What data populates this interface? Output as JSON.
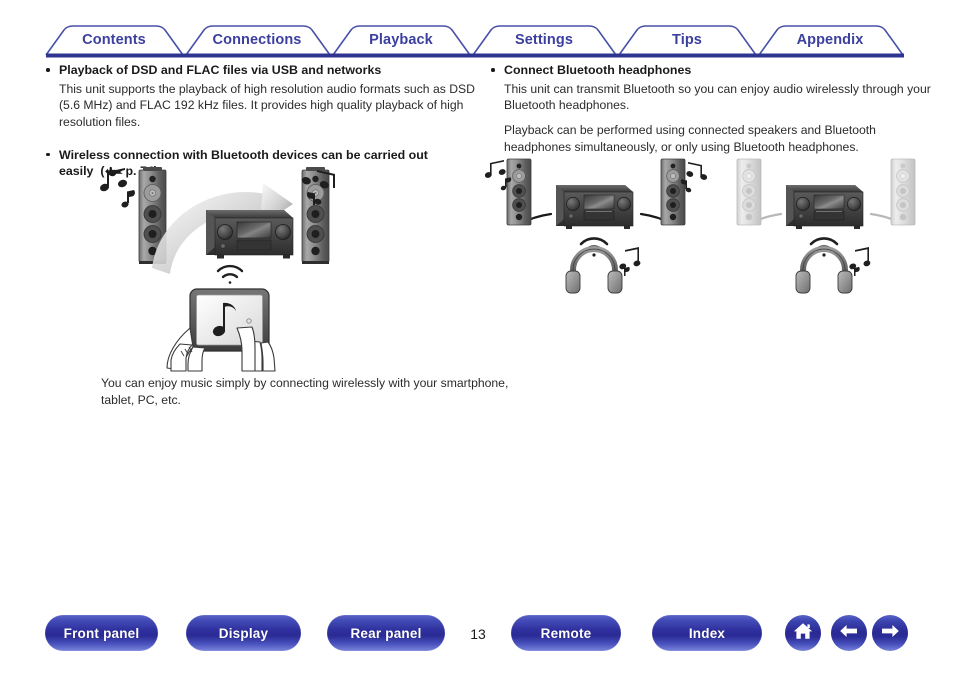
{
  "tabs": [
    {
      "label": "Contents"
    },
    {
      "label": "Connections"
    },
    {
      "label": "Playback"
    },
    {
      "label": "Settings"
    },
    {
      "label": "Tips"
    },
    {
      "label": "Appendix"
    }
  ],
  "theme": {
    "tab_text_color": "#3b3f9e",
    "tab_border_color": "#4950a8",
    "tab_rule_color": "#2f3490",
    "pill_color": "#2b2b96",
    "pill_text_color": "#ffffff",
    "body_text_color": "#2b2b2b"
  },
  "left_column": {
    "items": [
      {
        "heading": "Playback of DSD and FLAC files via USB and networks",
        "paragraphs": [
          "This unit supports the playback of high resolution audio formats such as DSD (5.6 MHz) and FLAC 192 kHz files. It provides high quality playback of high resolution files."
        ]
      },
      {
        "heading_part1": "Wireless connection with Bluetooth devices can be carried out",
        "heading_part2": "easily",
        "link_open": "(",
        "link_icon": "pointing-hand-icon",
        "link_text": "p. 74",
        "link_close": ")"
      }
    ],
    "caption": "You can enjoy music simply by connecting wirelessly with your smartphone, tablet, PC, etc.",
    "illustration": {
      "name": "wireless-streaming-diagram",
      "elements": [
        "left-speaker",
        "music-notes",
        "curved-arrow",
        "av-receiver",
        "right-speaker",
        "wifi-signal",
        "tablet-with-music-note",
        "hands"
      ]
    }
  },
  "right_column": {
    "items": [
      {
        "heading": "Connect Bluetooth headphones",
        "paragraphs": [
          "This unit can transmit Bluetooth so you can enjoy audio wirelessly through your Bluetooth headphones.",
          "Playback can be performed using connected speakers and Bluetooth headphones simultaneously, or only using Bluetooth headphones."
        ]
      }
    ],
    "illustration_a": {
      "name": "speakers-and-headphones-active-diagram",
      "elements": [
        "left-speaker-active",
        "music-notes",
        "av-receiver",
        "right-speaker-active",
        "bluetooth-signal",
        "headphones",
        "music-notes"
      ]
    },
    "illustration_b": {
      "name": "headphones-only-diagram",
      "elements": [
        "left-speaker-muted",
        "av-receiver",
        "right-speaker-muted",
        "bluetooth-signal",
        "headphones",
        "music-notes"
      ]
    }
  },
  "bottom_nav": {
    "buttons": [
      {
        "label": "Front panel"
      },
      {
        "label": "Display"
      },
      {
        "label": "Rear panel"
      },
      {
        "label": "Remote"
      },
      {
        "label": "Index"
      }
    ],
    "page_number": "13",
    "icons": [
      {
        "name": "home-icon"
      },
      {
        "name": "arrow-left-icon"
      },
      {
        "name": "arrow-right-icon"
      }
    ]
  }
}
